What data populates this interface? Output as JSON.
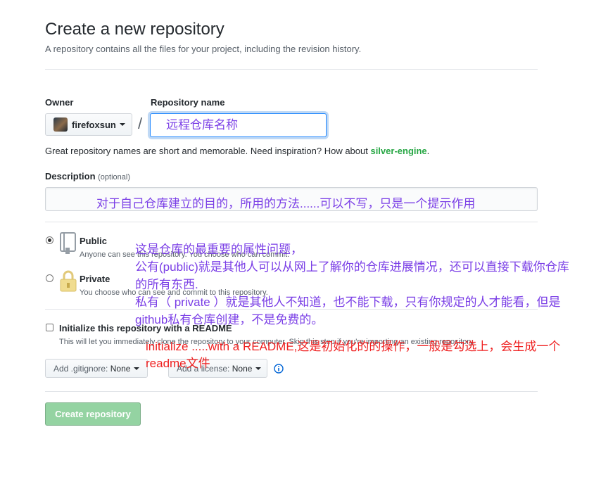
{
  "header": {
    "title": "Create a new repository",
    "subtitle": "A repository contains all the files for your project, including the revision history."
  },
  "owner": {
    "label": "Owner",
    "name": "firefoxsun"
  },
  "repo": {
    "label": "Repository name",
    "separator": "/",
    "value": "远程仓库名称"
  },
  "hint": {
    "text": "Great repository names are short and memorable. Need inspiration? How about ",
    "suggestion": "silver-engine",
    "end": "."
  },
  "description": {
    "label": "Description",
    "optional": "(optional)",
    "annotation": "对于自己仓库建立的目的，所用的方法......可以不写，只是一个提示作用"
  },
  "visibility": {
    "public": {
      "title": "Public",
      "note": "Anyone can see this repository. You choose who can commit.",
      "selected": true
    },
    "private": {
      "title": "Private",
      "note": "You choose who can see and commit to this repository.",
      "selected": false
    },
    "annotation_lines": [
      "这是仓库的最重要的属性问题，",
      "公有(public)就是其他人可以从网上了解你的仓库进展情况，还可以直接下载你仓库",
      "的所有东西.",
      "私有（ private ）就是其他人不知道，也不能下载，只有你规定的人才能看，但是",
      "github私有仓库创建，不是免费的。"
    ]
  },
  "readme": {
    "label": "Initialize this repository with a README",
    "note": "This will let you immediately clone the repository to your computer. Skip this step if you're importing an existing repository.",
    "checked": false,
    "annotation_lines": [
      "initialize .....with a README,这是初始化的的操作，一般是勾选上，会生成一个",
      "readme文件"
    ]
  },
  "gitignore": {
    "label": "Add .gitignore:",
    "value": "None"
  },
  "license": {
    "label": "Add a license:",
    "value": "None"
  },
  "create_button": "Create repository",
  "colors": {
    "annotation_purple": "#7a3ee6",
    "annotation_red": "#ef2020",
    "accent_blue": "#0366d6",
    "green_link": "#28a745",
    "button_disabled": "#94d3a2"
  }
}
